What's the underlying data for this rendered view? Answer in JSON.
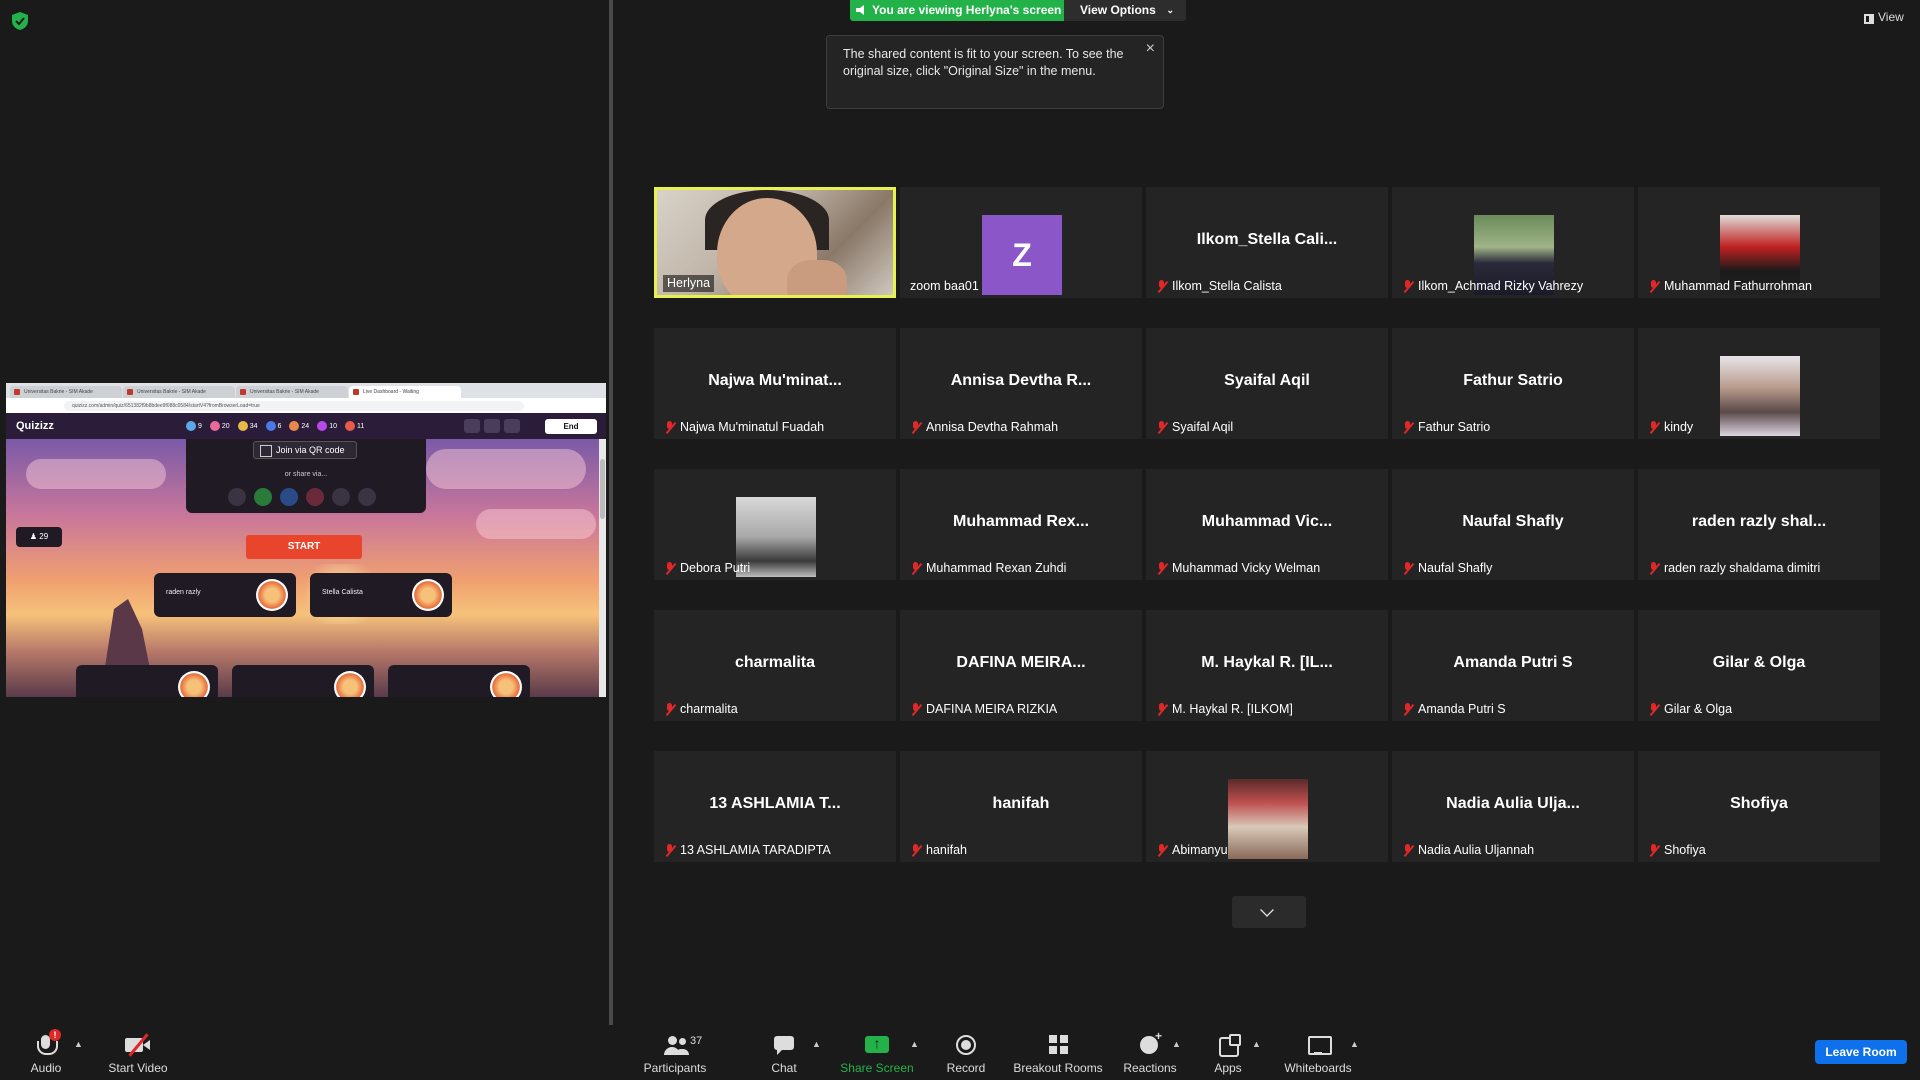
{
  "banner": {
    "viewing_text": "You are viewing Herlyna's screen",
    "view_options_label": "View Options",
    "view_label": "View"
  },
  "tooltip": {
    "text": "The shared content is fit to your screen. To see the original size, click \"Original Size\" in the menu."
  },
  "shared_screen": {
    "browser_tabs": [
      "Universitas Bakrie - SIM Akade",
      "Universitas Bakrie - SIM Akade",
      "Universitas Bakrie - SIM Akade",
      "Live Dashboard - Waiting"
    ],
    "url": "quizizz.com/admin/quiz/651382f9b8bdee9f088c0584/startV4?fromBrowserLoad=true",
    "app_logo": "Quizizz",
    "stats": [
      "9",
      "20",
      "34",
      "6",
      "24",
      "10",
      "11"
    ],
    "end_label": "End",
    "join_qr_label": "Join via QR code",
    "share_via_label": "or share via...",
    "players_count": "29",
    "start_label": "START",
    "players": [
      "raden razly",
      "Stella Calista"
    ]
  },
  "participants": [
    {
      "display": "",
      "label": "Herlyna",
      "muted": false,
      "video": "herlyna",
      "active": true
    },
    {
      "display": "Z",
      "label": "zoom baa01",
      "muted": false,
      "video": "avatar"
    },
    {
      "display": "Ilkom_Stella  Cali...",
      "label": "Ilkom_Stella Calista",
      "muted": true
    },
    {
      "display": "",
      "label": "Ilkom_Achmad Rizky Vahrezy",
      "muted": true,
      "video": "achmad"
    },
    {
      "display": "",
      "label": "Muhammad Fathurrohman",
      "muted": true,
      "video": "muhammad"
    },
    {
      "display": "Najwa  Mu'minat...",
      "label": "Najwa Mu'minatul Fuadah",
      "muted": true
    },
    {
      "display": "Annisa  Devtha  R...",
      "label": "Annisa Devtha Rahmah",
      "muted": true
    },
    {
      "display": "Syaifal Aqil",
      "label": "Syaifal Aqil",
      "muted": true
    },
    {
      "display": "Fathur Satrio",
      "label": "Fathur Satrio",
      "muted": true
    },
    {
      "display": "",
      "label": "kindy",
      "muted": true,
      "video": "kindy"
    },
    {
      "display": "",
      "label": "Debora Putri",
      "muted": true,
      "video": "debora"
    },
    {
      "display": "Muhammad  Rex...",
      "label": "Muhammad Rexan Zuhdi",
      "muted": true
    },
    {
      "display": "Muhammad  Vic...",
      "label": "Muhammad Vicky Welman",
      "muted": true
    },
    {
      "display": "Naufal Shafly",
      "label": "Naufal Shafly",
      "muted": true
    },
    {
      "display": "raden razly shal...",
      "label": "raden razly shaldama dimitri",
      "muted": true
    },
    {
      "display": "charmalita",
      "label": "charmalita",
      "muted": true
    },
    {
      "display": "DAFINA  MEIRA...",
      "label": "DAFINA MEIRA RIZKIA",
      "muted": true
    },
    {
      "display": "M.  Haykal  R.  [IL...",
      "label": "M. Haykal R. [ILKOM]",
      "muted": true
    },
    {
      "display": "Amanda Putri S",
      "label": "Amanda Putri S",
      "muted": true
    },
    {
      "display": "Gilar & Olga",
      "label": "Gilar & Olga",
      "muted": true
    },
    {
      "display": "13  ASHLAMIA  T...",
      "label": "13 ASHLAMIA TARADIPTA",
      "muted": true
    },
    {
      "display": "hanifah",
      "label": "hanifah",
      "muted": true
    },
    {
      "display": "",
      "label": "Abimanyu",
      "muted": true,
      "video": "abimanyu"
    },
    {
      "display": "Nadia Aulia Ulja...",
      "label": "Nadia Aulia Uljannah",
      "muted": true
    },
    {
      "display": "Shofiya",
      "label": "Shofiya",
      "muted": true
    }
  ],
  "toolbar": {
    "audio": "Audio",
    "start_video": "Start Video",
    "participants": "Participants",
    "participants_count": "37",
    "chat": "Chat",
    "share_screen": "Share Screen",
    "record": "Record",
    "breakout": "Breakout Rooms",
    "reactions": "Reactions",
    "apps": "Apps",
    "whiteboards": "Whiteboards",
    "leave": "Leave Room",
    "mic_badge": "!"
  },
  "colors": {
    "share_green": "#23b24a",
    "active_speaker": "#e5f24f",
    "leave_blue": "#0e71eb",
    "muted_red": "#e02828"
  }
}
